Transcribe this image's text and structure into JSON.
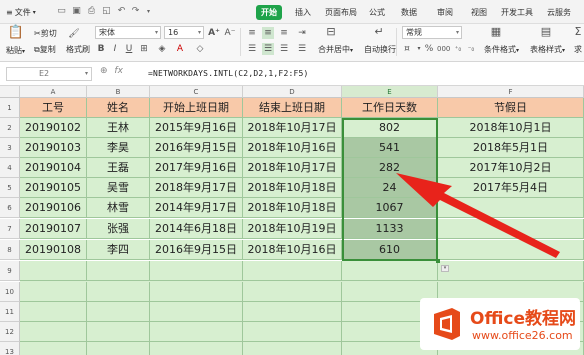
{
  "tabs": {
    "file": "文件",
    "items": [
      "开始",
      "插入",
      "页面布局",
      "公式",
      "数据",
      "审阅",
      "视图",
      "开发工具",
      "云服务"
    ],
    "active_index": 0
  },
  "ribbon": {
    "paste": "粘贴",
    "cut": "剪切",
    "copy": "复制",
    "format_painter": "格式刷",
    "font_name": "宋体",
    "font_size": "16",
    "merge_center": "合并居中",
    "wrap_text": "自动换行",
    "number_format": "常规",
    "cond_format": "条件格式",
    "table_style": "表格样式",
    "sum_label": "求"
  },
  "formula_bar": {
    "name_box": "E2",
    "fx": "fx",
    "formula": "=NETWORKDAYS.INTL(C2,D2,1,F2:F5)"
  },
  "columns": [
    "A",
    "B",
    "C",
    "D",
    "E",
    "F"
  ],
  "rows": [
    "1",
    "2",
    "3",
    "4",
    "5",
    "6",
    "7",
    "8",
    "9",
    "10",
    "11",
    "12",
    "13"
  ],
  "table": {
    "headers": [
      "工号",
      "姓名",
      "开始上班日期",
      "结束上班日期",
      "工作日天数",
      "节假日"
    ],
    "body": [
      [
        "20190102",
        "王林",
        "2015年9月16日",
        "2018年10月17日",
        "802",
        "2018年10月1日"
      ],
      [
        "20190103",
        "李昊",
        "2016年9月15日",
        "2018年10月16日",
        "541",
        "2018年5月1日"
      ],
      [
        "20190104",
        "王磊",
        "2017年9月16日",
        "2018年10月17日",
        "282",
        "2017年10月2日"
      ],
      [
        "20190105",
        "吴雪",
        "2018年9月17日",
        "2018年10月18日",
        "24",
        "2017年5月4日"
      ],
      [
        "20190106",
        "林雪",
        "2014年9月17日",
        "2018年10月18日",
        "1067",
        ""
      ],
      [
        "20190107",
        "张强",
        "2014年6月18日",
        "2018年10月19日",
        "1133",
        ""
      ],
      [
        "20190108",
        "李四",
        "2016年9月15日",
        "2018年10月16日",
        "610",
        ""
      ]
    ]
  },
  "logo": {
    "title": "Office教程网",
    "url": "www.office26.com"
  },
  "colors": {
    "accent": "#1fa34a",
    "header_fill": "#f8c9a9",
    "cell_fill": "#d7efd0",
    "selected_fill": "#a9c8a3",
    "arrow": "#e8231b"
  }
}
